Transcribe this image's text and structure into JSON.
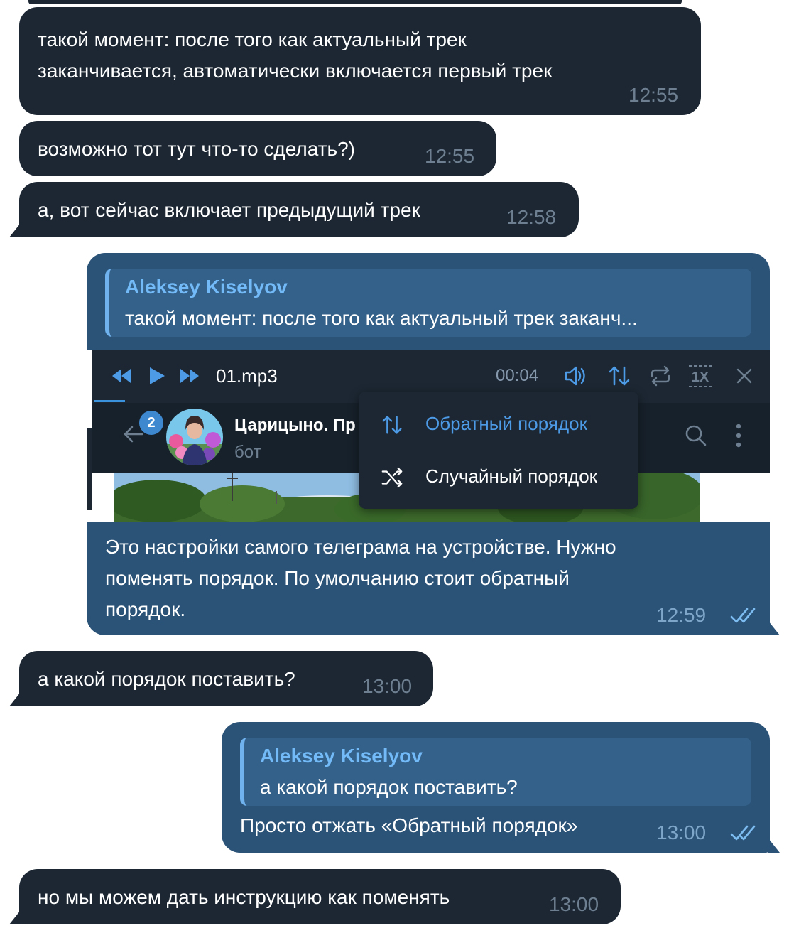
{
  "messages": [
    {
      "id": "m1",
      "dir": "in",
      "lines": [
        "такой момент: после того как актуальный трек",
        "заканчивается, автоматически включается первый трек"
      ],
      "time": "12:55"
    },
    {
      "id": "m2",
      "dir": "in",
      "lines": [
        "возможно тот тут что-то сделать?)"
      ],
      "time": "12:55"
    },
    {
      "id": "m3",
      "dir": "in",
      "lines": [
        "а, вот сейчас включает предыдущий трек"
      ],
      "time": "12:58"
    },
    {
      "id": "m4",
      "dir": "out",
      "reply": {
        "name": "Aleksey Kiselyov",
        "text": "такой момент: после того как актуальный трек заканч..."
      },
      "lines": [
        "Это настройки самого телеграма на устройстве. Нужно",
        "поменять порядок. По умолчанию стоит обратный",
        "порядок."
      ],
      "time": "12:59",
      "read": true
    },
    {
      "id": "m5",
      "dir": "in",
      "lines": [
        "а какой порядок поставить?"
      ],
      "time": "13:00"
    },
    {
      "id": "m6",
      "dir": "out",
      "reply": {
        "name": "Aleksey Kiselyov",
        "text": "а какой порядок поставить?"
      },
      "lines": [
        "Просто отжать «Обратный порядок»"
      ],
      "time": "13:00",
      "read": true
    },
    {
      "id": "m7",
      "dir": "in",
      "lines": [
        "но мы можем дать инструкцию как поменять"
      ],
      "time": "13:00"
    }
  ],
  "screenshot": {
    "player": {
      "track": "01.mp3",
      "time": "00:04",
      "speed": "1X",
      "icons": [
        "rewind-icon",
        "play-icon",
        "fast-forward-icon",
        "volume-icon",
        "order-icon",
        "repeat-icon",
        "speed-icon",
        "close-icon"
      ]
    },
    "chat": {
      "title": "Царицыно. Пр",
      "subtitle": "бот",
      "unread_badge": "2",
      "icons": [
        "back-arrow-icon",
        "search-icon",
        "more-vertical-icon"
      ]
    },
    "order_menu": [
      {
        "label": "Обратный порядок",
        "icon": "reverse-order-icon",
        "active": true
      },
      {
        "label": "Случайный порядок",
        "icon": "shuffle-icon",
        "active": false
      }
    ]
  },
  "colors": {
    "incoming_bubble": "#1c2733",
    "outgoing_bubble": "#2b5378",
    "reply_name": "#72baf8",
    "accent": "#4d9ae6"
  }
}
